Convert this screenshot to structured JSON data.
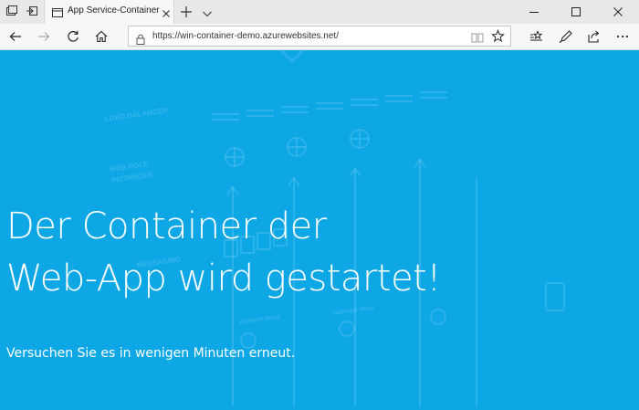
{
  "browser": {
    "tab": {
      "title": "App Service-Container"
    },
    "address_bar": {
      "url": "https://win-container-demo.azurewebsites.net/"
    }
  },
  "page": {
    "headline_line1": "Der Container der",
    "headline_line2": "Web-App wird gestartet!",
    "subtext": "Versuchen Sie es in wenigen Minuten erneut.",
    "background_labels": {
      "load_balancer": "LOAD BALANCER",
      "web_role_1": "WEB ROLE",
      "web_role_2": "INSTANCES",
      "messaging": "MESSAGING",
      "worker_role_1": "WORKER ROLE",
      "worker_role_2": "WORKER ROLE"
    }
  },
  "colors": {
    "page_background": "#0ea7e6",
    "chrome_background": "#e8e8e8",
    "active_tab": "#f7f7f7",
    "text_on_page": "#ffffff"
  },
  "icons": {
    "tab_actions": [
      "tab-preview-icon",
      "set-tabs-aside-icon"
    ],
    "navigation": [
      "back-icon",
      "forward-icon",
      "refresh-icon",
      "home-icon"
    ],
    "toolbar": [
      "favorites-hub-icon",
      "web-note-icon",
      "share-icon",
      "more-icon"
    ],
    "window": [
      "minimize-icon",
      "maximize-icon",
      "close-icon"
    ]
  }
}
